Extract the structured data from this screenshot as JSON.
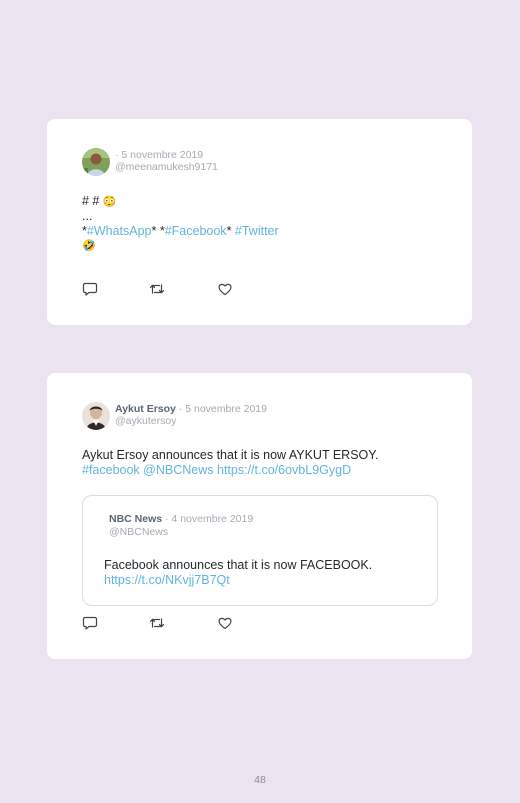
{
  "tweets": [
    {
      "name": "",
      "separator": "·",
      "date": "5 novembre 2019",
      "handle": "@meenamukesh9171",
      "lines": {
        "l1": "# # ",
        "l1_emoji": "😳",
        "l2": "...",
        "l3a": "*",
        "l3b": "#WhatsApp",
        "l3c": "* *",
        "l3d": "#Facebook",
        "l3e": "* ",
        "l3f": "#Twitter",
        "l4_emoji": "🤣"
      }
    },
    {
      "name": "Aykut Ersoy",
      "separator": "·",
      "date": "5 novembre 2019",
      "handle": "@aykutersoy",
      "lines": {
        "l1": "Aykut Ersoy announces that it is now AYKUT ERSOY.",
        "l2a": "#facebook",
        "l2b": " ",
        "l2c": "@NBCNews",
        "l2d": " ",
        "l2e": "https://t.co/6ovbL9GygD"
      },
      "quote": {
        "name": "NBC News",
        "separator": "·",
        "date": "4 novembre 2019",
        "handle": "@NBCNews",
        "l1": "Facebook announces that it is now FACEBOOK.",
        "l2": "https://t.co/NKvjj7B7Qt"
      }
    }
  ],
  "icons": {
    "reply": "reply-icon",
    "retweet": "retweet-icon",
    "like": "heart-icon"
  },
  "colors": {
    "background": "#ebe3f0",
    "card": "#ffffff",
    "link": "#62b4dd",
    "muted": "#a4abb3",
    "name": "#5b6673",
    "text": "#24292e"
  },
  "page_number": "48"
}
